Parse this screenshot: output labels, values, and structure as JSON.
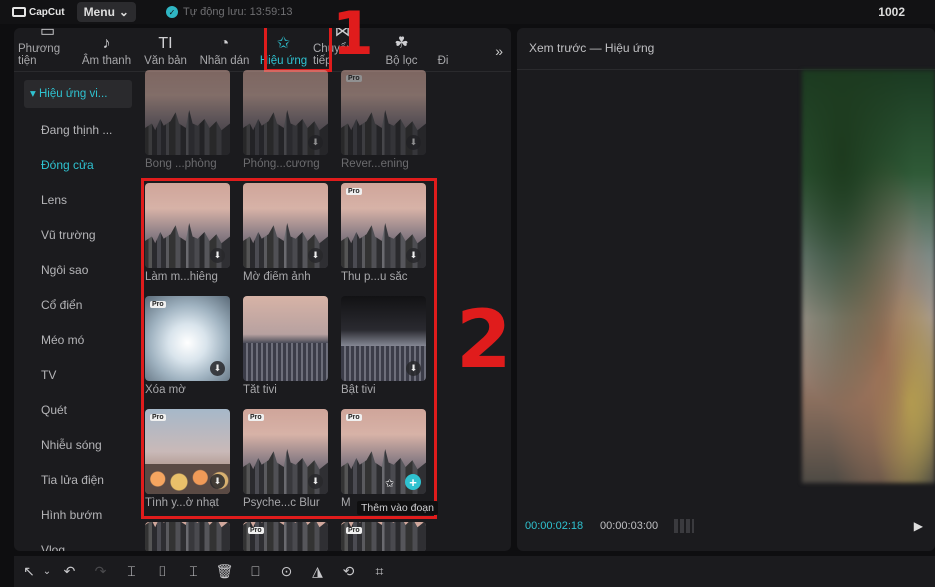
{
  "app": {
    "logo": "CapCut",
    "menu": "Menu",
    "menu_caret": "⌄",
    "autosave": "Tự động lưu: 13:59:13",
    "counter": "1002"
  },
  "toolbar": {
    "tabs": [
      {
        "icon": "▭",
        "label": "Phương tiện"
      },
      {
        "icon": "♪",
        "label": "Âm thanh"
      },
      {
        "icon": "TI",
        "label": "Văn bản"
      },
      {
        "icon": "◔",
        "label": "Nhãn dán"
      },
      {
        "icon": "✩",
        "label": "Hiệu ứng"
      },
      {
        "icon": "⋈",
        "label": "Chuyển tiếp"
      },
      {
        "icon": "☘",
        "label": "Bộ lọc"
      },
      {
        "icon": "",
        "label": "Đi"
      }
    ],
    "more": "»"
  },
  "sidebar": {
    "items": [
      "▾ Hiệu ứng vi...",
      "Đang thịnh ...",
      "Đóng cửa",
      "Lens",
      "Vũ trường",
      "Ngôi sao",
      "Cổ điển",
      "Méo mó",
      "TV",
      "Quét",
      "Nhiễu sóng",
      "Tia lửa điện",
      "Hình bướm",
      "Vlog"
    ]
  },
  "effects": {
    "row0": [
      "Bong ...phòng",
      "Phóng...cương",
      "Rever...ening"
    ],
    "row1": [
      "Làm m...hiêng",
      "Mờ điểm ảnh",
      "Thu p...u sắc"
    ],
    "row2": [
      "Xóa mờ",
      "Tắt tivi",
      "Bật tivi"
    ],
    "row3": [
      "Tình y...ờ nhạt",
      "Psyche...c Blur",
      "M"
    ],
    "pro_badge": "Pro",
    "download_icon": "⬇",
    "add_icon": "+",
    "star_icon": "✩",
    "tooltip": "Thêm vào đoạn"
  },
  "annotations": {
    "n1": "1",
    "n2": "2"
  },
  "preview": {
    "title": "Xem trước — Hiệu ứng",
    "current_time": "00:00:02:18",
    "total_time": "00:00:03:00",
    "play_icon": "▶"
  },
  "bottom_toolbar": {
    "icons": [
      "↖",
      "⌄",
      "↶",
      "↷",
      "⌶",
      "⌷",
      "⌶",
      "🗑",
      "⎕",
      "⊙",
      "◮",
      "⟲",
      "⌗"
    ]
  }
}
